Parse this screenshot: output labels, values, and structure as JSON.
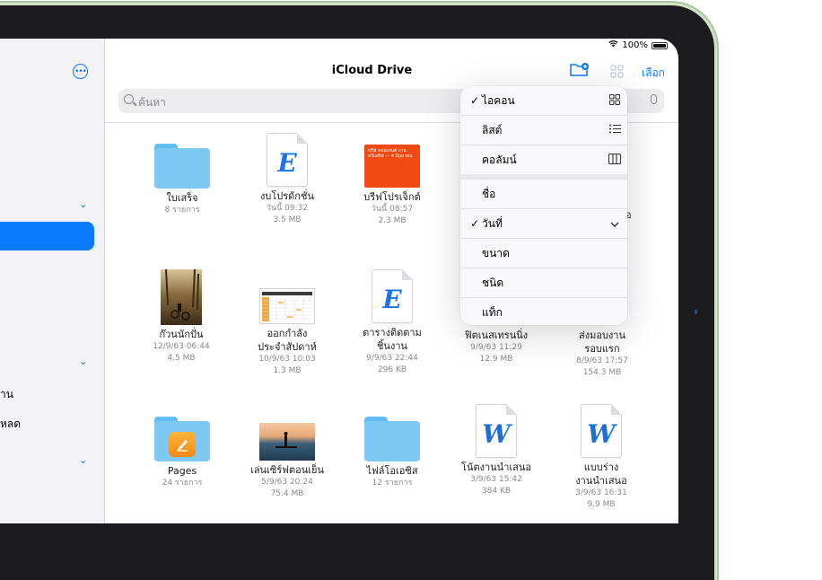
{
  "status": {
    "battery": "100%"
  },
  "header": {
    "title": "iCloud Drive",
    "select_label": "เลือก"
  },
  "search": {
    "placeholder": "ค้นหา"
  },
  "sidebar": {
    "labels": [
      "าน",
      "หลด"
    ]
  },
  "menu": {
    "view_options": [
      {
        "label": "ไอคอน",
        "checked": true,
        "icon": "grid-icon"
      },
      {
        "label": "ลิสต์",
        "checked": false,
        "icon": "list-icon"
      },
      {
        "label": "คอลัมน์",
        "checked": false,
        "icon": "columns-icon"
      }
    ],
    "sort_options": [
      {
        "label": "ชื่อ",
        "checked": false
      },
      {
        "label": "วันที่",
        "checked": true,
        "icon": "chevron-down-icon"
      },
      {
        "label": "ขนาด",
        "checked": false
      },
      {
        "label": "ชนิด",
        "checked": false
      },
      {
        "label": "แท็ก",
        "checked": false
      }
    ]
  },
  "files": [
    {
      "name": "ใบเสร็จ",
      "meta1": "8 รายการ",
      "meta2": "",
      "kind": "folder"
    },
    {
      "name": "งบโปรดักชั่น",
      "meta1": "วันนี้ 09:32",
      "meta2": "3.5 MB",
      "kind": "keynote-doc"
    },
    {
      "name": "บรีฟโปรเจ็กต์",
      "meta1": "วันนี้ 08:57",
      "meta2": "2.3 MB",
      "kind": "orange-doc",
      "thumb_text": "บรีฟ คอนเทนต์ งานครีเอทีฟ — 4 มิถุนายน"
    },
    {
      "name": "ก๊วนนักปั่น",
      "meta1": "12/9/63 06:44",
      "meta2": "4.5 MB",
      "kind": "photo-bikes"
    },
    {
      "name": "ออกกำลัง ประจำสัปดาห์",
      "name_line1": "ออกกำลัง",
      "name_line2": "ประจำสัปดาห์",
      "meta1": "10/9/63 10:03",
      "meta2": "1.3 MB",
      "kind": "spreadsheet"
    },
    {
      "name": "ตารางติดตาม ชิ้นงาน",
      "name_line1": "ตารางติดตาม",
      "name_line2": "ชิ้นงาน",
      "meta1": "9/9/63 22:44",
      "meta2": "296 KB",
      "kind": "keynote-doc"
    },
    {
      "name": "ฟิตเนสเทรนนิ่ง",
      "meta1": "9/9/63 11:29",
      "meta2": "12.9 MB",
      "kind": "hidden"
    },
    {
      "name": "ส่งมอบงาน รอบแรก",
      "name_line1": "ส่งมอบงาน",
      "name_line2": "รอบแรก",
      "meta1": "8/9/63 17:57",
      "meta2": "154.3 MB",
      "kind": "hidden"
    },
    {
      "name": "Pages",
      "meta1": "24 รายการ",
      "meta2": "",
      "kind": "pages-folder"
    },
    {
      "name": "เล่นเซิร์ฟตอนเย็น",
      "meta1": "5/9/63 20:24",
      "meta2": "75.4 MB",
      "kind": "photo-surf"
    },
    {
      "name": "ไฟล์โอเอซิส",
      "meta1": "12 รายการ",
      "meta2": "",
      "kind": "folder"
    },
    {
      "name": "โน้ตงานนำเสนอ",
      "meta1": "3/9/63 15:42",
      "meta2": "384 KB",
      "kind": "word-doc"
    },
    {
      "name": "แบบร่าง งานนำเสนอ",
      "name_line1": "แบบร่าง",
      "name_line2": "งานนำเสนอ",
      "meta1": "3/9/63 16:31",
      "meta2": "9.9 MB",
      "kind": "word-doc"
    }
  ],
  "partial_label": "อ",
  "colors": {
    "accent": "#0a7aff",
    "folder": "#7cc9f4",
    "orange": "#f04a12"
  }
}
